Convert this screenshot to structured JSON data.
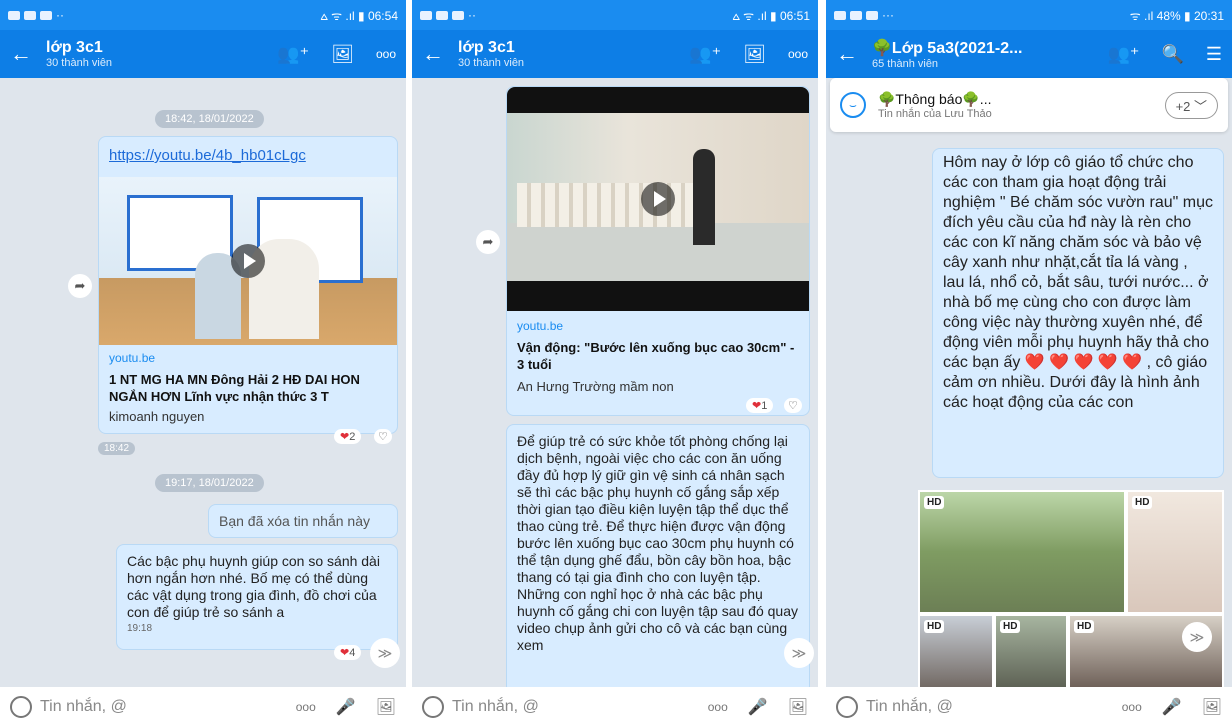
{
  "screens": [
    {
      "status": {
        "left_dots": "··",
        "right": "⩟ ᯤ .ıl ▮ 06:54"
      },
      "header": {
        "title": "lớp 3c1",
        "members": "30 thành viên"
      },
      "date1": "18:42, 18/01/2022",
      "link_msg": {
        "url": "https://youtu.be/4b_hb01cLgc",
        "source": "youtu.be",
        "title": "1 NT MG HA MN Đông Hải 2 HĐ DAI HON NGẮN HƠN  Lĩnh vực nhận thức  3 T",
        "author": "kimoanh nguyen",
        "reaction": "2",
        "time": "18:42"
      },
      "date2": "19:17, 18/01/2022",
      "deleted_msg": "Bạn đã xóa tin nhắn này",
      "text_msg": {
        "text": "Các bậc phụ huynh giúp con so sánh dài hơn ngắn hơn nhé.  Bố mẹ có thể dùng các vật dụng trong gia đình, đồ chơi của con để giúp trẻ so sánh a",
        "time": "19:18",
        "reaction": "4"
      },
      "input": {
        "placeholder": "Tin nhắn, @"
      }
    },
    {
      "status": {
        "left_dots": "··",
        "right": "⩟ ᯤ .ıl ▮ 06:51"
      },
      "header": {
        "title": "lớp 3c1",
        "members": "30 thành viên"
      },
      "video_msg": {
        "source": "youtu.be",
        "title": "Vận động: \"Bước lên xuống bục cao 30cm\" - 3 tuổi",
        "author": "An Hưng Trường mầm non",
        "reaction": "1"
      },
      "text_msg": {
        "text": "Để giúp trẻ có sức khỏe tốt phòng chống lại dịch bệnh,  ngoài việc cho các con ăn uống đầy đủ hợp lý giữ gìn vệ sinh cá nhân sạch sẽ thì các bậc phụ huynh cố gắng sắp xếp thời gian tạo điều kiện luyện tập thể dục thể thao cùng trẻ.  Để thực hiện được vận động bước lên xuống bục cao 30cm phụ huynh có thể tận dụng ghế đẩu,  bồn cây bồn hoa, bậc thang có tại gia đình cho con luyện tập.  Những con nghỉ học ở nhà các bậc phụ huynh cố gắng chi con luyện tập sau đó quay video chụp ảnh gửi cho cô và các bạn cùng xem"
      },
      "input": {
        "placeholder": "Tin nhắn, @"
      }
    },
    {
      "status": {
        "left_dots": "···",
        "right": "ᯤ .ıl 48% ▮ 20:31"
      },
      "header": {
        "title": "🌳Lớp 5a3(2021-2...",
        "members": "65 thành viên"
      },
      "notice": {
        "title": "🌳Thông báo🌳...",
        "sub": "Tin nhắn của Lưu Thảo",
        "button": "+2 ﹀"
      },
      "text_msg": {
        "text": "Hôm nay ở lớp cô giáo tổ chức cho các con tham gia hoạt động trải nghiệm \" Bé chăm sóc vườn rau\"  mục đích yêu cầu của hđ này là rèn cho các con kĩ năng chăm sóc và bảo vệ cây xanh như nhặt,cắt tỉa lá vàng , lau lá, nhổ cỏ, bắt sâu, tưới nước... ở nhà bố mẹ cùng cho con được làm công việc này thường xuyên nhé, để động viên mỗi  phụ huynh hãy thả cho các bạn ấy ❤️ ❤️ ❤️ ❤️ ❤️ , cô giáo cảm ơn nhiều. Dưới đây là hình ảnh các hoạt động của các con"
      },
      "hd_label": "HD",
      "input": {
        "placeholder": "Tin nhắn, @"
      }
    }
  ],
  "icons": {
    "back": "←",
    "add_member": "👥⁺",
    "album": "🖼",
    "more": "ooo",
    "search": "🔍",
    "menu": "☰",
    "mic": "🎤",
    "image": "🖼",
    "forward": "➦",
    "heart": "❤",
    "heart_outline": "♡",
    "scroll_down": "≫"
  },
  "colors": {
    "header": "#0d7ee6",
    "status": "#1a8cf0",
    "chat_bg": "#dfe5ec",
    "bubble": "#d8ecff"
  }
}
